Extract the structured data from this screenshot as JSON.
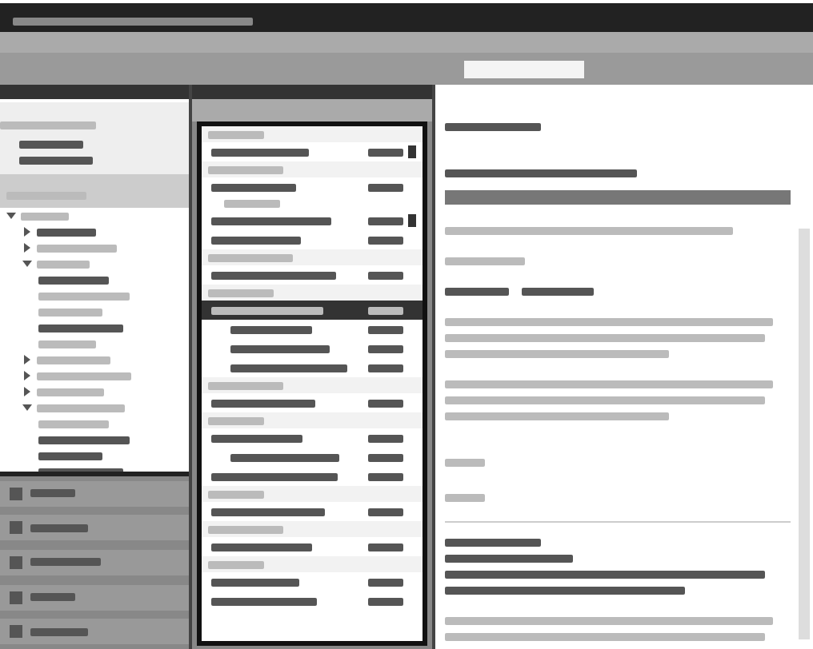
{
  "favorites": [
    {
      "selected": false
    },
    {
      "selected": false
    }
  ],
  "folders": [
    {
      "expanded": true,
      "children": [
        {
          "unread": true,
          "expanded": false
        },
        {
          "unread": false,
          "expanded": false
        },
        {
          "unread": false,
          "expanded": true,
          "children": [
            {
              "unread": true
            },
            {
              "unread": false
            },
            {
              "unread": false
            },
            {
              "unread": true
            },
            {
              "unread": false
            }
          ]
        },
        {
          "unread": false,
          "expanded": false
        },
        {
          "unread": false,
          "expanded": false
        },
        {
          "unread": false,
          "expanded": false
        },
        {
          "unread": false,
          "expanded": true,
          "children": [
            {
              "unread": false
            },
            {
              "unread": true
            },
            {
              "unread": true
            },
            {
              "unread": true
            }
          ]
        }
      ]
    }
  ],
  "nav_buttons": [
    {
      "selected": false
    },
    {
      "selected": false
    },
    {
      "selected": false
    },
    {
      "selected": false
    },
    {
      "selected": false
    }
  ],
  "messages": [
    {
      "kind": "group"
    },
    {
      "kind": "message",
      "flagged": true,
      "selected": false
    },
    {
      "kind": "group"
    },
    {
      "kind": "message",
      "flagged": false,
      "selected": false
    },
    {
      "kind": "note"
    },
    {
      "kind": "message",
      "flagged": true,
      "selected": false
    },
    {
      "kind": "message",
      "flagged": false,
      "selected": false
    },
    {
      "kind": "group"
    },
    {
      "kind": "message",
      "flagged": false,
      "selected": false
    },
    {
      "kind": "group"
    },
    {
      "kind": "message",
      "flagged": false,
      "selected": true
    },
    {
      "kind": "reply",
      "flagged": false,
      "selected": false
    },
    {
      "kind": "reply",
      "flagged": false,
      "selected": false
    },
    {
      "kind": "reply",
      "flagged": false,
      "selected": false
    },
    {
      "kind": "group"
    },
    {
      "kind": "message",
      "flagged": false,
      "selected": false
    },
    {
      "kind": "group"
    },
    {
      "kind": "message",
      "flagged": false,
      "selected": false
    },
    {
      "kind": "reply",
      "flagged": false,
      "selected": false
    },
    {
      "kind": "message",
      "flagged": false,
      "selected": false
    },
    {
      "kind": "group"
    },
    {
      "kind": "message",
      "flagged": false,
      "selected": false
    },
    {
      "kind": "group"
    },
    {
      "kind": "message",
      "flagged": false,
      "selected": false
    },
    {
      "kind": "group"
    },
    {
      "kind": "message",
      "flagged": false,
      "selected": false
    },
    {
      "kind": "message",
      "flagged": false,
      "selected": false
    }
  ],
  "reading_pane": [
    {
      "kind": "subject"
    },
    {
      "kind": "sender"
    },
    {
      "kind": "banner"
    },
    {
      "kind": "recipients"
    },
    {
      "kind": "attachments"
    },
    {
      "kind": "paragraph"
    },
    {
      "kind": "paragraph"
    },
    {
      "kind": "signoff"
    },
    {
      "kind": "signoff"
    },
    {
      "kind": "rule"
    },
    {
      "kind": "quote_header"
    },
    {
      "kind": "paragraph"
    }
  ]
}
